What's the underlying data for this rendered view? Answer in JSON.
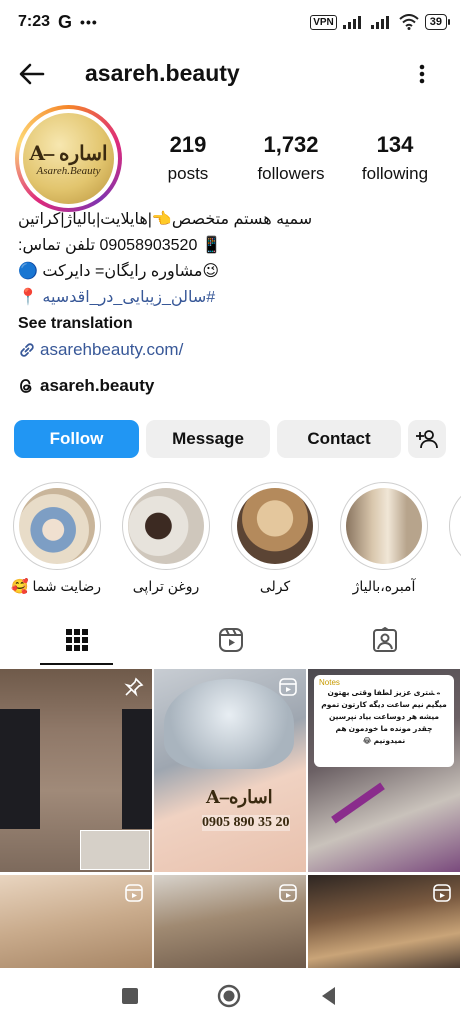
{
  "status_bar": {
    "time": "7:23",
    "carrier_glyph": "G",
    "vpn": "VPN",
    "battery": "39"
  },
  "header": {
    "username": "asareh.beauty"
  },
  "profile": {
    "avatar_brand": "Asareh.Beauty",
    "stats": [
      {
        "value": "219",
        "label": "posts"
      },
      {
        "value": "1,732",
        "label": "followers"
      },
      {
        "value": "134",
        "label": "following"
      }
    ],
    "bio_lines": [
      "سمیه هستم متخصص👈|هایلایت|بالیاژ|کراتین",
      "📱 09058903520 تلفن تماس:",
      "😉مشاوره رایگان= دایرکت 🔵",
      "📍"
    ],
    "hashtag": "#سالن_زیبایی_در_اقدسیه",
    "see_translation": "See translation",
    "link": "asarehbeauty.com/",
    "threads_handle": "asareh.beauty"
  },
  "buttons": {
    "follow": "Follow",
    "message": "Message",
    "contact": "Contact"
  },
  "highlights": [
    {
      "label": "رضایت شما 🥰"
    },
    {
      "label": "روغن تراپی"
    },
    {
      "label": "کرلی"
    },
    {
      "label": "آمبره،بالیاژ"
    }
  ],
  "posts": {
    "post2_phone": "0905 890 35 20",
    "post3_note_title": "Notes",
    "post3_note_text": "مشتری عزیز لطفا وقتی بهتون میگیم نیم ساعت دیگه کارتون تموم میشه هر دوساعت بیاد نپرسین چقدر مونده ما خودمون هم نمیدونیم 😂"
  },
  "icons": {
    "back": "arrow-left-icon",
    "more": "more-vertical-icon",
    "link": "link-icon",
    "threads": "threads-icon",
    "add_user": "add-user-icon",
    "grid": "grid-icon",
    "reels": "reels-icon",
    "tagged": "tagged-icon",
    "pin": "pin-icon",
    "reel_badge": "reel-badge-icon"
  },
  "colors": {
    "follow_button": "#2196f3",
    "link": "#385898"
  }
}
